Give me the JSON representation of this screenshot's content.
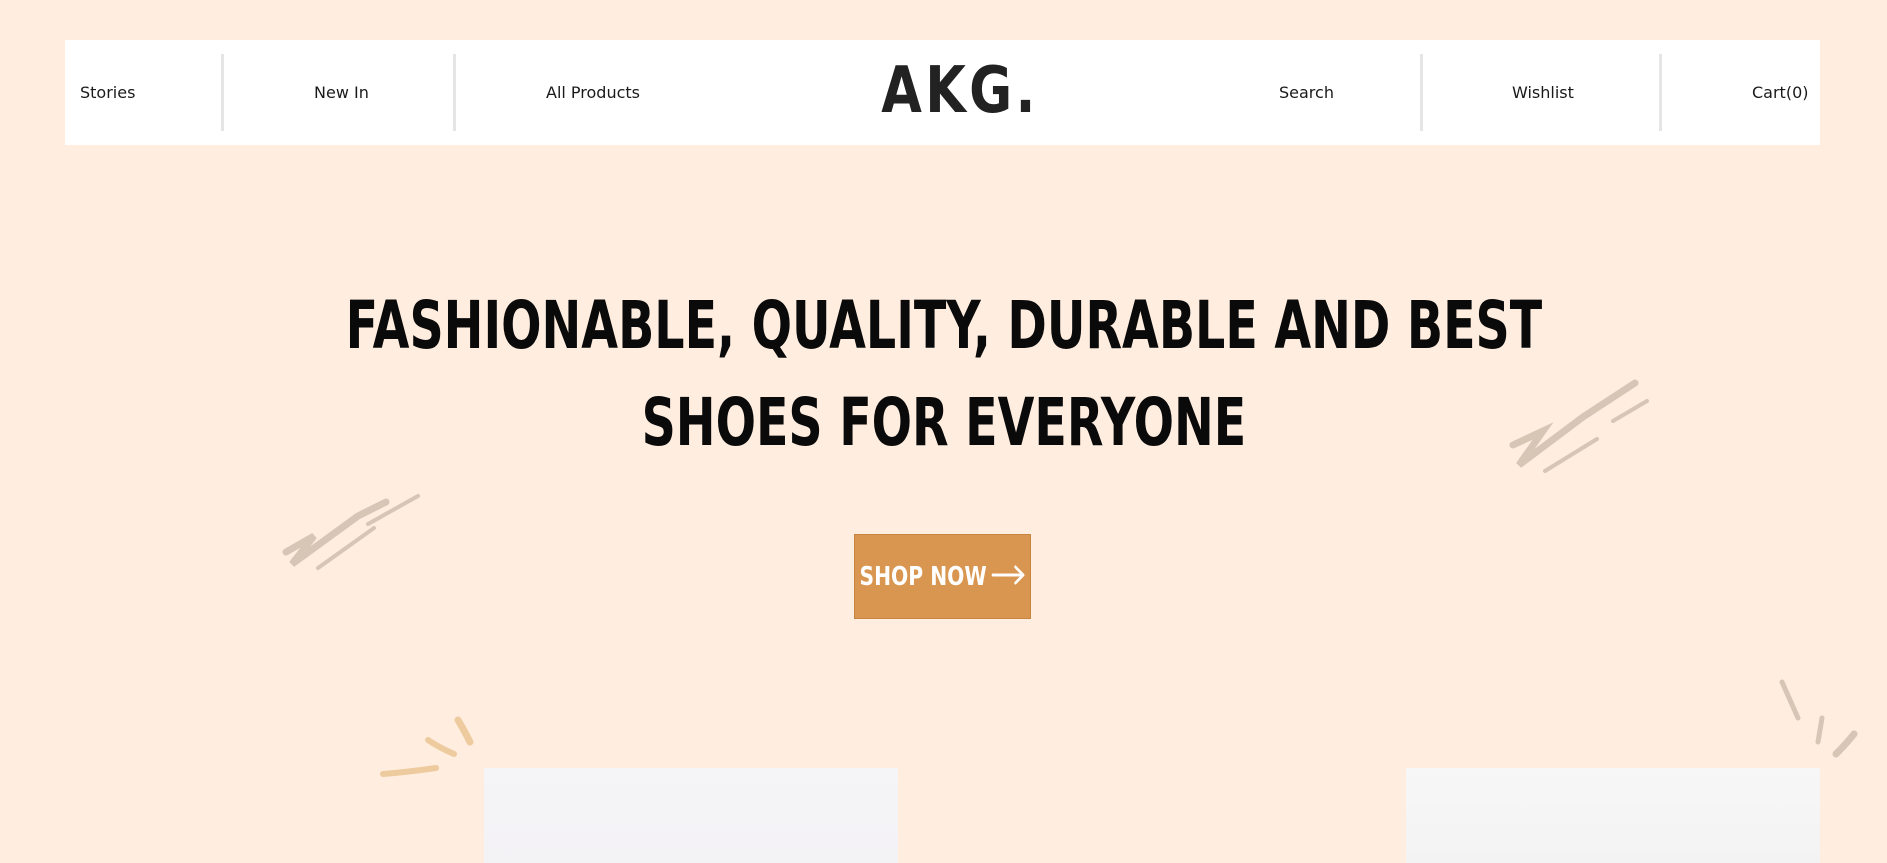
{
  "nav": {
    "stories": "Stories",
    "new_in": "New In",
    "all_products": "All Products",
    "logo": "AKG.",
    "search": "Search",
    "wishlist": "Wishlist",
    "cart": "Cart(0)"
  },
  "hero": {
    "line1": "FASHIONABLE, QUALITY, DURABLE AND BEST",
    "line2": "SHOES FOR EVERYONE",
    "cta_label": "SHOP NOW",
    "cta_icon": "arrow-right-icon"
  },
  "colors": {
    "background": "#ffede0",
    "navbar": "#ffffff",
    "cta": "#d99650",
    "text": "#0a0a0a"
  }
}
